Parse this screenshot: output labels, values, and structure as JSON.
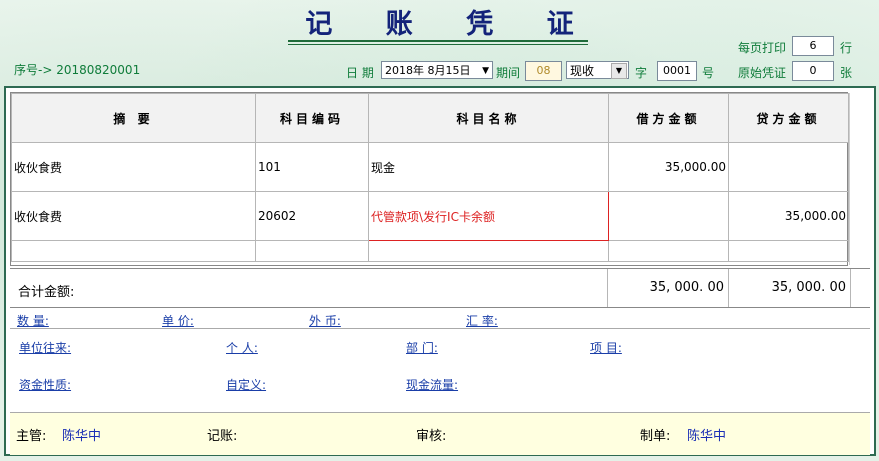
{
  "title": "记 账 凭 证",
  "serial": {
    "label": "序号->",
    "value": "20180820001"
  },
  "date": {
    "label": "日 期",
    "value": "2018年  8月15日"
  },
  "period": {
    "label": "期间",
    "value": "08"
  },
  "voucher_type": {
    "value": "现收",
    "label": "字"
  },
  "voucher_no": {
    "value": "0001",
    "label": "号"
  },
  "print_per_page": {
    "label": "每页打印",
    "value": "6",
    "unit": "行"
  },
  "attachments": {
    "label": "原始凭证",
    "value": "0",
    "unit": "张"
  },
  "table": {
    "headers": [
      "摘  要",
      "科目编码",
      "科目名称",
      "借方金额",
      "贷方金额"
    ],
    "rows": [
      {
        "summary": "收伙食费",
        "code": "101",
        "name": "现金",
        "debit": "35,000.00",
        "credit": ""
      },
      {
        "summary": "收伙食费",
        "code": "20602",
        "name": "代管款项\\发行IC卡余额",
        "debit": "",
        "credit": "35,000.00"
      }
    ]
  },
  "total": {
    "label": "合计金额:",
    "debit": "35, 000. 00",
    "credit": "35, 000. 00"
  },
  "aux1": {
    "qty": "数 量:",
    "price": "单 价:",
    "fx": "外 币:",
    "rate": "汇 率:"
  },
  "aux2": {
    "unit": "单位往来:",
    "person": "个   人:",
    "dept": "部     门:",
    "project": "项   目:"
  },
  "aux3": {
    "fund": "资金性质:",
    "custom": "自定义:",
    "cashflow": "现金流量:"
  },
  "footer": {
    "supervisor_label": "主管:",
    "supervisor": "陈华中",
    "bookkeeper_label": "记账:",
    "auditor_label": "审核:",
    "maker_label": "制单:",
    "maker": "陈华中"
  },
  "colors": {
    "title": "#13237a",
    "label_green": "#0f7c3a",
    "link": "#1a3ea8",
    "error_red": "#dd2222",
    "footer_bg": "#ffffe0"
  }
}
